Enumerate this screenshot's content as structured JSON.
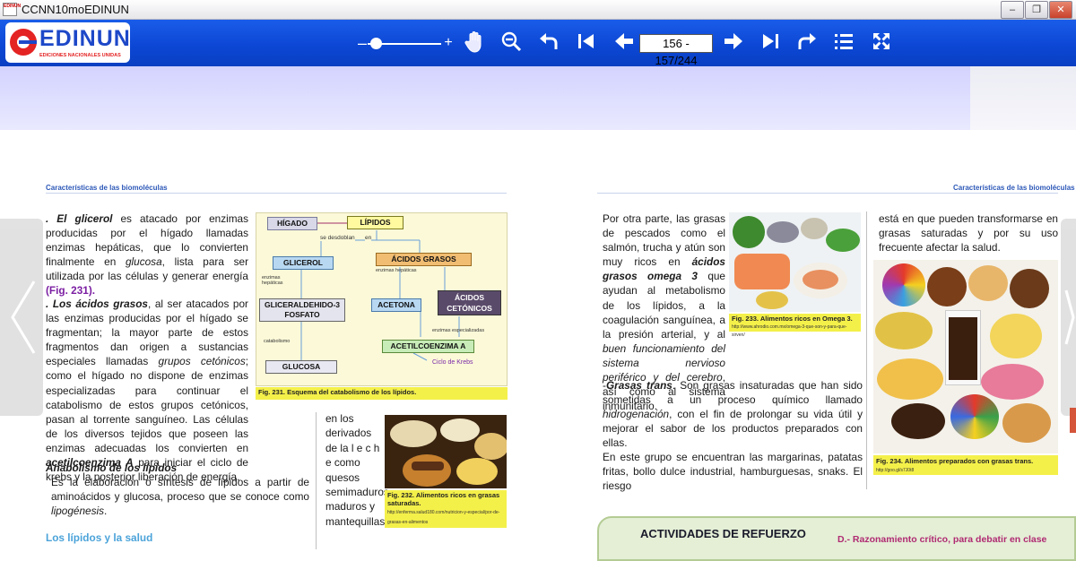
{
  "window": {
    "title": "CCNN10moEDINUN",
    "app_icon_text": "EDINUN"
  },
  "logo": {
    "name": "EDINUN",
    "tagline": "EDICIONES NACIONALES UNIDAS"
  },
  "toolbar": {
    "zoom_out": "–",
    "zoom_in": "+",
    "page_value": "156 - 157/244",
    "icons": [
      "hand-icon",
      "zoom-out-icon",
      "undo-icon",
      "first-page-icon",
      "previous-page-icon",
      "next-page-icon",
      "last-page-icon",
      "redo-icon",
      "list-icon",
      "fullscreen-icon"
    ],
    "zoom_level": 0.04
  },
  "left_page": {
    "header": "Características de las biomoléculas",
    "glicerol_head": ". El glicerol",
    "glicerol_text": " es atacado por enzimas producidas por el hígado llamadas enzimas hepáticas, que lo convierten finalmente en ",
    "glicerol_italic": "glucosa",
    "glicerol_tail": ", lista para ser utilizada por las células y generar energía ",
    "glicerol_ref": "(Fig. 231).",
    "acidos_head": ". Los ácidos grasos",
    "acidos_text1": ", al ser atacados por las enzimas producidas por el hígado se fragmentan; la mayor parte de estos fragmentos dan origen a sustancias especiales llamadas ",
    "acidos_italic": "grupos cetónicos",
    "acidos_text2": "; como el hígado no dispone de enzimas especializadas para continuar el catabolismo de estos grupos cetónicos, pasan al torrente sanguíneo. Las células de los diversos tejidos que poseen las enzimas adecuadas los convierten en ",
    "acidos_bold": "acetilcoenzima A",
    "acidos_text3": " para iniciar el ciclo de krebs y la posterior liberación de energía.",
    "anabolismo_head": "Anabolismo de los lípidos",
    "anabolismo_text": "Es la elaboración o síntesis de lípidos  a partir de aminoácidos y glucosa, proceso que se conoce como ",
    "anabolismo_italic": "lipogénesis",
    "anabolismo_end": ".",
    "section_link": "Los lípidos y la salud",
    "fig231": {
      "caption": "Fig. 231. Esquema del catabolismo de los lípidos.",
      "higado": "HÍGADO",
      "lipidos": "LÍPIDOS",
      "se_desdoblan": "se desdoblan",
      "en": "en",
      "glicerol": "GLICEROL",
      "acidos_grasos": "ÁCIDOS GRASOS",
      "enzimas_hepaticas": "enzimas hepáticas",
      "enzimas_hepaticas_left": "enzimas hepáticas",
      "gliceraldehido": "GLICERALDEHIDO-3 FOSFATO",
      "acetona": "ACETONA",
      "acidos_cetonicos": "ÁCIDOS CETÓNICOS",
      "catabolismo": "catabolismo",
      "enzimas_especializadas": "enzimas especializadas",
      "acetilcoenzima": "ACETILCOENZIMA A",
      "ciclo_krebs": "Ciclo de Krebs",
      "glucosa": "GLUCOSA"
    },
    "col2_text": "en los derivados de la l e c h e como quesos semimaduros, maduros y mantequillas.",
    "fig232": {
      "caption": "Fig. 232. Alimentos ricos en grasas saturadas.",
      "url": "http://enferma.salud180.com/nutricion-y-especial/por-de-grasas-en-alimentos"
    }
  },
  "right_page": {
    "header": "Características de las biomoléculas",
    "para1_a": "Por otra parte, las grasas de pescados como el salmón, trucha y atún son muy ricos en ",
    "para1_bold": "ácidos grasos omega 3",
    "para1_b": " que ayudan al metabolismo de los lípidos, a la coagulación sanguínea, a la presión arterial, y al ",
    "para1_italic": "buen funcionamiento del sistema nervioso periférico y del cerebro",
    "para1_c": ", así como al sistema inmunitario.",
    "trans_head": "Grasas trans",
    "trans_text": ". Son grasas insaturadas que han sido sometidas a un proceso químico llamado ",
    "trans_italic": "hidrogenación",
    "trans_tail": ", con el fin de prolongar su vida útil  y mejorar el sabor de los productos preparados con ellas.",
    "para3": "En este grupo se encuentran las margarinas, patatas fritas, bollo dulce industrial, hamburguesas, snaks. El riesgo",
    "col2_top": "está en que pueden transformarse en grasas saturadas y por su uso frecuente afectar la salud.",
    "fig233": {
      "caption": "Fig. 233. Alimentos ricos en Omega 3.",
      "url": "http://www.ahrodio.com.mx/omega-3-que-son-y-para-que-sirven/"
    },
    "fig234": {
      "caption": "Fig. 234. Alimentos preparados con grasas trans.",
      "url": "http://goo.gl/s7J0t8"
    },
    "activities_title": "ACTIVIDADES  DE REFUERZO",
    "activities_right": "D.- Razonamiento crítico, para debatir en clase"
  },
  "colors": {
    "toolbar_blue": "#0b46d3",
    "header_blue": "#2d58b8",
    "caption_yellow": "#f4f04a",
    "purple_ref": "#7b1fa2"
  }
}
